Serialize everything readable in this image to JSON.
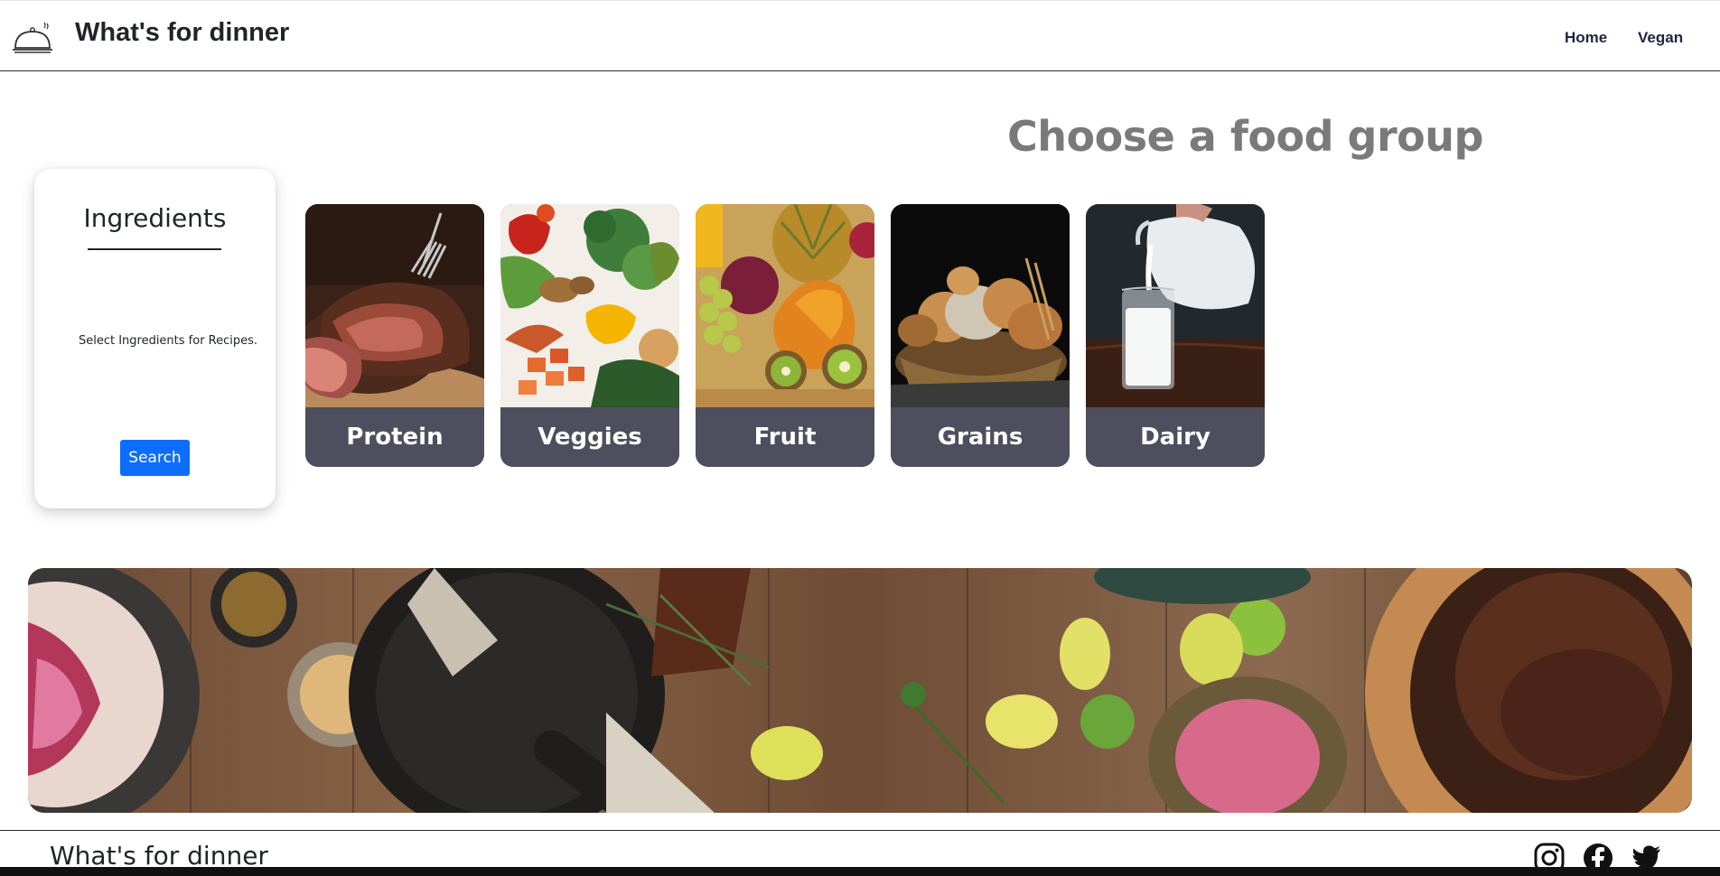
{
  "navbar": {
    "brand_icon": "cloche-icon",
    "title": "What's for dinner",
    "links": [
      "Home",
      "Vegan"
    ]
  },
  "main": {
    "heading": "Choose a food group"
  },
  "ingredients": {
    "title": "Ingredients",
    "placeholder_text": "Select Ingredients for Recipes.",
    "search_label": "Search"
  },
  "food_groups": [
    {
      "label": "Protein",
      "image": "sliced-steak-photo"
    },
    {
      "label": "Veggies",
      "image": "assorted-vegetables-photo"
    },
    {
      "label": "Fruit",
      "image": "fruit-basket-photo"
    },
    {
      "label": "Grains",
      "image": "bread-basket-photo"
    },
    {
      "label": "Dairy",
      "image": "milk-pour-photo"
    }
  ],
  "banner": {
    "image": "rustic-table-food-spread-photo"
  },
  "footer": {
    "title": "What's for dinner",
    "social_icons": [
      "instagram-icon",
      "facebook-icon",
      "twitter-icon"
    ]
  },
  "colors": {
    "card_label_bg": "#4e4e5e",
    "primary_button": "#0d6efd",
    "heading": "#7a7a7a",
    "nav_link": "#1c2641"
  }
}
